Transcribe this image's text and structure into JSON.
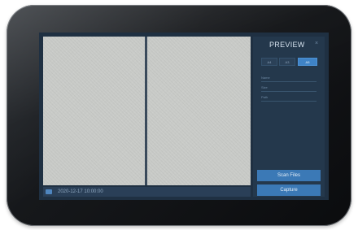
{
  "preview_panel": {
    "title": "PREVIEW",
    "close_glyph": "×",
    "segments": [
      {
        "label": "A4"
      },
      {
        "label": "A3"
      },
      {
        "label": "A5",
        "active": true
      }
    ],
    "fields": [
      {
        "label": "Name"
      },
      {
        "label": "Size"
      },
      {
        "label": "Path"
      }
    ],
    "scan_files_label": "Scan Files",
    "capture_label": "Capture"
  },
  "status_bar": {
    "text": "2020-12-17 10:00:00"
  },
  "colors": {
    "screen_bg": "#1f3042",
    "panel_bg": "#24384c",
    "accent": "#3b79b6",
    "page": "#c9cbc8"
  }
}
